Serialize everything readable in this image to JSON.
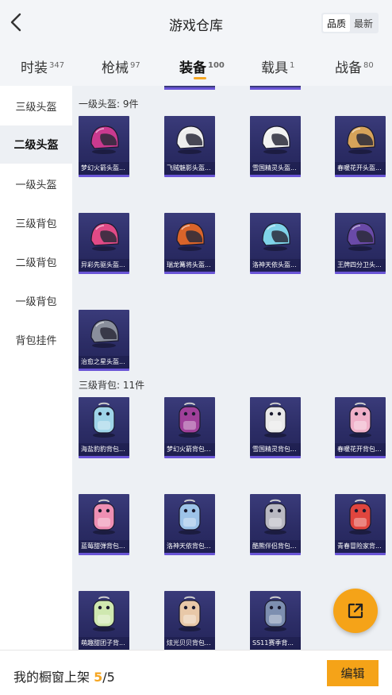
{
  "header": {
    "title": "游戏仓库",
    "sort_options": [
      {
        "label": "品质",
        "active": true
      },
      {
        "label": "最新",
        "active": false
      }
    ]
  },
  "categories": [
    {
      "label": "时装",
      "count": "347",
      "active": false
    },
    {
      "label": "枪械",
      "count": "97",
      "active": false
    },
    {
      "label": "装备",
      "count": "100",
      "active": true
    },
    {
      "label": "载具",
      "count": "1",
      "active": false
    },
    {
      "label": "战备",
      "count": "80",
      "active": false
    }
  ],
  "sidebar": {
    "items": [
      {
        "label": "三级头盔",
        "active": false
      },
      {
        "label": "二级头盔",
        "active": true
      },
      {
        "label": "一级头盔",
        "active": false
      },
      {
        "label": "三级背包",
        "active": false
      },
      {
        "label": "二级背包",
        "active": false
      },
      {
        "label": "一级背包",
        "active": false
      },
      {
        "label": "背包挂件",
        "active": false
      }
    ]
  },
  "sections": [
    {
      "title": "一级头盔: 9件",
      "items": [
        {
          "name": "梦幻火箭头盔...",
          "icon": "helmet-icon",
          "color": "#c93a8f"
        },
        {
          "name": "飞贼魅影头盔...",
          "icon": "helmet-icon",
          "color": "#eeeeee"
        },
        {
          "name": "雪国精灵头盔...",
          "icon": "helmet-icon",
          "color": "#f2f2f2"
        },
        {
          "name": "春暖花开头盔...",
          "icon": "helmet-icon",
          "color": "#d7a35a"
        },
        {
          "name": "异彩先驱头盔...",
          "icon": "helmet-icon",
          "color": "#e04a86"
        },
        {
          "name": "瑞龙篝将头盔...",
          "icon": "helmet-icon",
          "color": "#d9642a"
        },
        {
          "name": "洛神天依头盔...",
          "icon": "helmet-icon",
          "color": "#7fd3e8"
        },
        {
          "name": "王牌四分卫头...",
          "icon": "helmet-icon",
          "color": "#6a4aa8"
        },
        {
          "name": "治愈之星头盔...",
          "icon": "helmet-icon",
          "color": "#8a8f9c"
        }
      ]
    },
    {
      "title": "三级背包: 11件",
      "items": [
        {
          "name": "海盐豹豹背包...",
          "icon": "backpack-icon",
          "color": "#9fd4e8"
        },
        {
          "name": "梦幻火箭背包...",
          "icon": "backpack-icon",
          "color": "#a0409a"
        },
        {
          "name": "雪国精灵背包...",
          "icon": "backpack-icon",
          "color": "#e9e9e9"
        },
        {
          "name": "春暖花开背包...",
          "icon": "backpack-icon",
          "color": "#f0b0c8"
        },
        {
          "name": "蓝莓甜弹背包...",
          "icon": "backpack-icon",
          "color": "#ee8fb3"
        },
        {
          "name": "洛神天依背包...",
          "icon": "backpack-icon",
          "color": "#9dc3e8"
        },
        {
          "name": "酷熊伴侣背包...",
          "icon": "backpack-icon",
          "color": "#b9b9c2"
        },
        {
          "name": "青春冒险家背...",
          "icon": "backpack-icon",
          "color": "#e0453e"
        },
        {
          "name": "萌趣甜团子背...",
          "icon": "backpack-icon",
          "color": "#cfe8b0"
        },
        {
          "name": "炫光贝贝背包...",
          "icon": "backpack-icon",
          "color": "#e8c8a8"
        },
        {
          "name": "SS11赛季背...",
          "icon": "backpack-icon",
          "color": "#7d8fb0"
        }
      ]
    }
  ],
  "footer": {
    "label": "我的橱窗上架",
    "current": "5",
    "total": "/5",
    "edit_label": "编辑"
  },
  "fab": {
    "icon": "share-icon"
  },
  "colors": {
    "accent": "#f5a318",
    "card_bg": "#2c2d66",
    "card_border": "#6a55d6",
    "content_bg": "#edf0f4"
  }
}
